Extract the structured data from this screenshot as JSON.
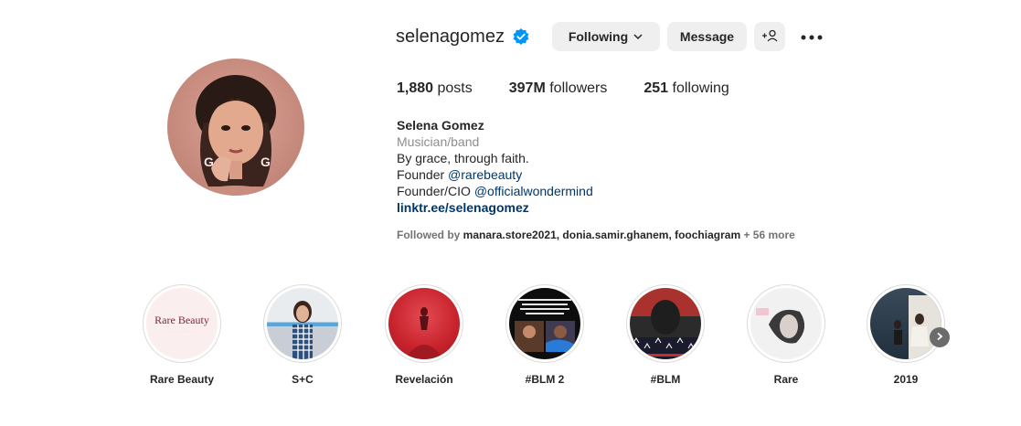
{
  "profile": {
    "username": "selenagomez",
    "verified_icon": "verified-badge-icon",
    "avatar_icon": "profile-avatar",
    "accent": "#0095f6"
  },
  "actions": {
    "following_label": "Following",
    "message_label": "Message",
    "add_user_icon": "add-user-icon",
    "more_icon": "more-options-icon"
  },
  "stats": [
    {
      "value": "1,880",
      "label": "posts"
    },
    {
      "value": "397M",
      "label": "followers"
    },
    {
      "value": "251",
      "label": "following"
    }
  ],
  "bio": {
    "name": "Selena Gomez",
    "category": "Musician/band",
    "line1": "By grace, through faith.",
    "line2_prefix": "Founder ",
    "line2_mention": "@rarebeauty",
    "line3_prefix": "Founder/CIO ",
    "line3_mention": "@officialwondermind",
    "link": "linktr.ee/selenagomez"
  },
  "followed_by": {
    "prefix": "Followed by ",
    "names": "manara.store2021, donia.samir.ghanem, foochiagram",
    "more": " + 56 more"
  },
  "highlights": [
    {
      "label": "Rare Beauty",
      "cover_text": "Rare Beauty"
    },
    {
      "label": "S+C"
    },
    {
      "label": "Revelación"
    },
    {
      "label": "#BLM 2"
    },
    {
      "label": "#BLM"
    },
    {
      "label": "Rare"
    },
    {
      "label": "2019"
    }
  ],
  "navigation": {
    "next_icon": "chevron-right-icon"
  }
}
